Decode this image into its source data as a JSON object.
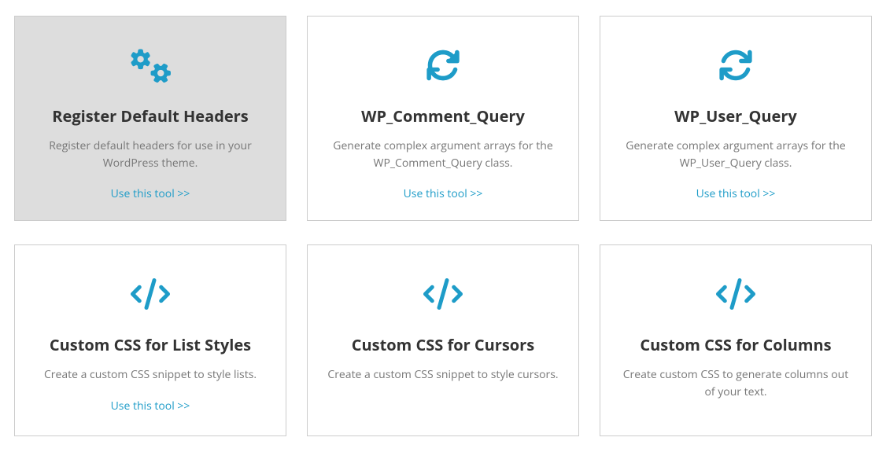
{
  "cards": [
    {
      "icon": "gears",
      "title": "Register Default Headers",
      "desc": "Register default headers for use in your WordPress theme.",
      "link": "Use this tool >>",
      "hovered": true
    },
    {
      "icon": "refresh",
      "title": "WP_Comment_Query",
      "desc": "Generate complex argument arrays for the WP_Comment_Query class.",
      "link": "Use this tool >>",
      "hovered": false
    },
    {
      "icon": "refresh",
      "title": "WP_User_Query",
      "desc": "Generate complex argument arrays for the WP_User_Query class.",
      "link": "Use this tool >>",
      "hovered": false
    },
    {
      "icon": "code",
      "title": "Custom CSS for List Styles",
      "desc": "Create a custom CSS snippet to style lists.",
      "link": "Use this tool >>",
      "hovered": false
    },
    {
      "icon": "code",
      "title": "Custom CSS for Cursors",
      "desc": "Create a custom CSS snippet to style cursors.",
      "link": "",
      "hovered": false
    },
    {
      "icon": "code",
      "title": "Custom CSS for Columns",
      "desc": "Create custom CSS to generate columns out of your text.",
      "link": "",
      "hovered": false
    }
  ]
}
